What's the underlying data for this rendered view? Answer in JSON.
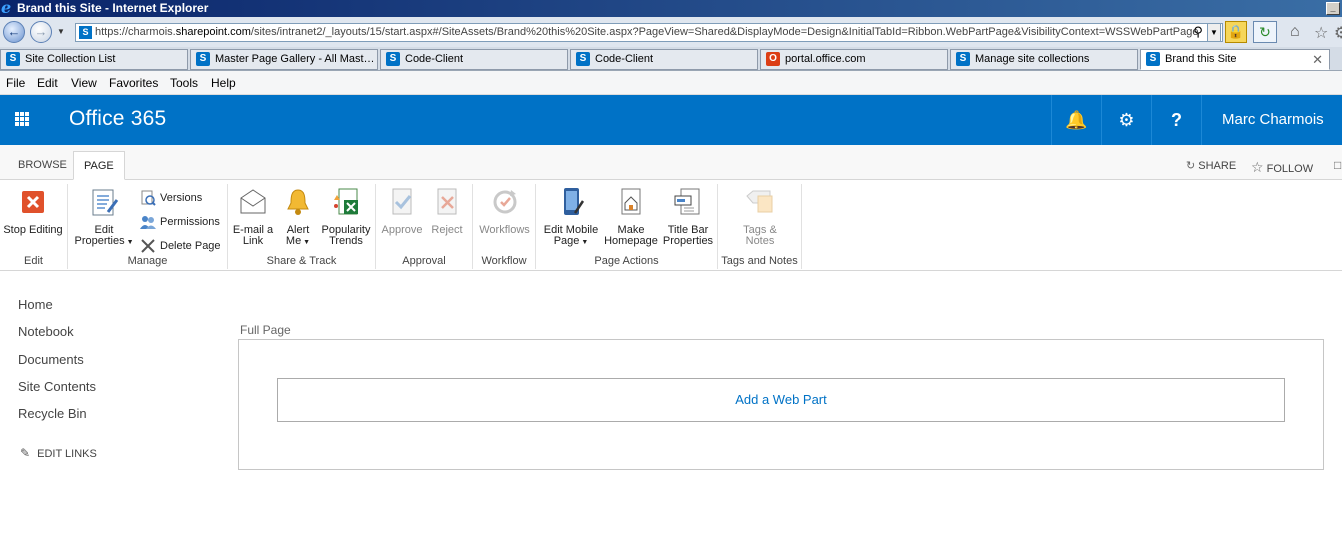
{
  "window": {
    "title": "Brand this Site - Internet Explorer"
  },
  "address": {
    "prefix": "https://charmois.",
    "host": "sharepoint.com",
    "path": "/sites/intranet2/_layouts/15/start.aspx#/SiteAssets/Brand%20this%20Site.aspx?PageView=Shared&DisplayMode=Design&InitialTabId=Ribbon.WebPartPage&VisibilityContext=WSSWebPartPage"
  },
  "tabs": [
    {
      "label": "Site Collection List",
      "icon": "sharepoint"
    },
    {
      "label": "Master Page Gallery - All Mast…",
      "icon": "sharepoint"
    },
    {
      "label": "Code-Client",
      "icon": "sharepoint"
    },
    {
      "label": "Code-Client",
      "icon": "sharepoint"
    },
    {
      "label": "portal.office.com",
      "icon": "office"
    },
    {
      "label": "Manage site collections",
      "icon": "sharepoint"
    },
    {
      "label": "Brand this Site",
      "icon": "sharepoint"
    }
  ],
  "menu": [
    "File",
    "Edit",
    "View",
    "Favorites",
    "Tools",
    "Help"
  ],
  "suite": {
    "brand": "Office 365",
    "user": "Marc Charmois"
  },
  "ribbon_tabs": {
    "browse": "BROWSE",
    "page": "PAGE",
    "share": "SHARE",
    "follow": "FOLLOW"
  },
  "ribbon": {
    "edit": {
      "label": "Edit",
      "stop_editing": "Stop Editing"
    },
    "manage": {
      "label": "Manage",
      "edit_properties_1": "Edit",
      "edit_properties_2": "Properties",
      "versions": "Versions",
      "permissions": "Permissions",
      "delete_page": "Delete Page"
    },
    "share_track": {
      "label": "Share & Track",
      "email_1": "E-mail a",
      "email_2": "Link",
      "alert_1": "Alert",
      "alert_2": "Me",
      "popularity_1": "Popularity",
      "popularity_2": "Trends"
    },
    "approval": {
      "label": "Approval",
      "approve": "Approve",
      "reject": "Reject"
    },
    "workflow": {
      "label": "Workflow",
      "workflows": "Workflows"
    },
    "page_actions": {
      "label": "Page Actions",
      "mobile_1": "Edit Mobile",
      "mobile_2": "Page",
      "homepage_1": "Make",
      "homepage_2": "Homepage",
      "titlebar_1": "Title Bar",
      "titlebar_2": "Properties"
    },
    "tags_notes": {
      "label": "Tags and Notes",
      "tags_1": "Tags &",
      "tags_2": "Notes"
    }
  },
  "leftnav": {
    "items": [
      "Home",
      "Notebook",
      "Documents",
      "Site Contents",
      "Recycle Bin"
    ],
    "edit_links": "EDIT LINKS"
  },
  "content": {
    "zone_title": "Full Page",
    "add_web_part": "Add a Web Part"
  }
}
